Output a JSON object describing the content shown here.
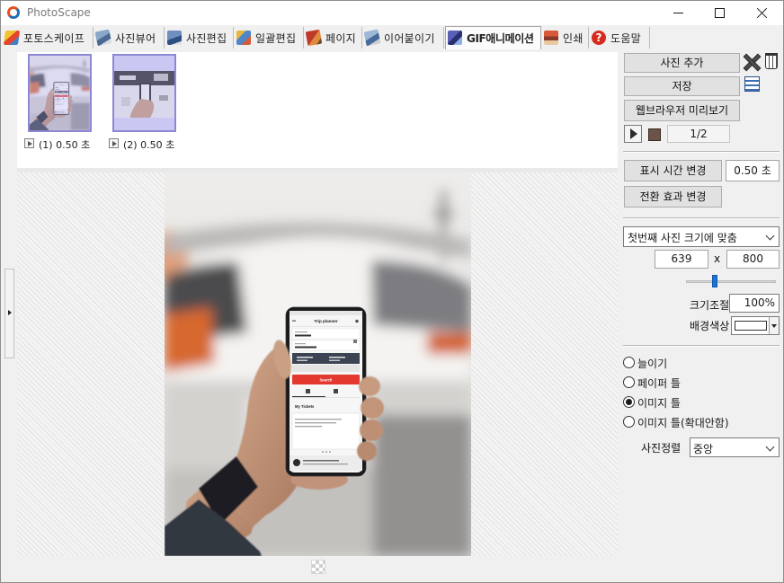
{
  "window": {
    "title": "PhotoScape"
  },
  "tabs": [
    {
      "label": "포토스케이프",
      "icon": "photoscape-home-icon",
      "active": false
    },
    {
      "label": "사진뷰어",
      "icon": "viewer-icon",
      "active": false
    },
    {
      "label": "사진편집",
      "icon": "editor-icon",
      "active": false
    },
    {
      "label": "일괄편집",
      "icon": "batch-editor-icon",
      "active": false
    },
    {
      "label": "페이지",
      "icon": "page-icon",
      "active": false
    },
    {
      "label": "이어붙이기",
      "icon": "combine-icon",
      "active": false
    },
    {
      "label": "GIF애니메이션",
      "icon": "gif-animation-icon",
      "active": true
    },
    {
      "label": "인쇄",
      "icon": "print-icon",
      "active": false
    },
    {
      "label": "도움말",
      "icon": "help-icon",
      "active": false
    }
  ],
  "frames": [
    {
      "label": "(1) 0.50 초"
    },
    {
      "label": "(2) 0.50 초"
    }
  ],
  "controls": {
    "add_photo": "사진 추가",
    "save": "저장",
    "browser_preview": "웹브라우저 미리보기",
    "frame_counter": "1/2",
    "change_display_time": "표시 시간 변경",
    "display_time_value": "0.50 초",
    "change_transition": "전환 효과 변경",
    "size_mode": "첫번째 사진 크기에 맞춤",
    "canvas_size_fields": [
      "639",
      "800"
    ],
    "size_separator": "x",
    "scale_slider_level": 0.32,
    "scale_label": "크기조절",
    "scale_value": "100%",
    "bg_color_label": "배경색상",
    "bg_color": "#ffffff",
    "fit_options": [
      {
        "label": "늘이기",
        "checked": false
      },
      {
        "label": "페이퍼 틀",
        "checked": false
      },
      {
        "label": "이미지 틀",
        "checked": true
      },
      {
        "label": "이미지 틀(확대안함)",
        "checked": false
      }
    ],
    "align_label": "사진정렬",
    "align_value": "중앙"
  },
  "photo_screen": {
    "title": "Trip planner",
    "button": "Search",
    "section": "My Tickets"
  }
}
